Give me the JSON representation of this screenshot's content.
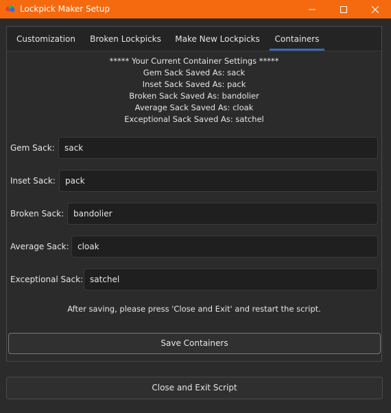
{
  "window": {
    "title": "Lockpick Maker Setup",
    "icon": "lockpick-app-icon",
    "controls": {
      "minimize": "–",
      "maximize": "☐",
      "close": "✕"
    },
    "accent_color": "#f56a0f"
  },
  "tabs": [
    {
      "label": "Customization"
    },
    {
      "label": "Broken Lockpicks"
    },
    {
      "label": "Make New Lockpicks"
    },
    {
      "label": "Containers",
      "active": true
    }
  ],
  "current_settings": {
    "header": "***** Your Current Container Settings *****",
    "lines": [
      "Gem Sack Saved As: sack",
      "Inset Sack Saved As: pack",
      "Broken Sack Saved As: bandolier",
      "Average Sack Saved As: cloak",
      "Exceptional Sack Saved As: satchel"
    ]
  },
  "form": [
    {
      "label": "Gem Sack:",
      "value": "sack"
    },
    {
      "label": "Inset Sack:",
      "value": "pack"
    },
    {
      "label": "Broken Sack:",
      "value": "bandolier"
    },
    {
      "label": "Average Sack:",
      "value": "cloak"
    },
    {
      "label": "Exceptional Sack:",
      "value": "satchel"
    }
  ],
  "note": "After saving, please press 'Close and Exit' and restart the script.",
  "save_button": "Save Containers",
  "exit_button": "Close and Exit Script"
}
